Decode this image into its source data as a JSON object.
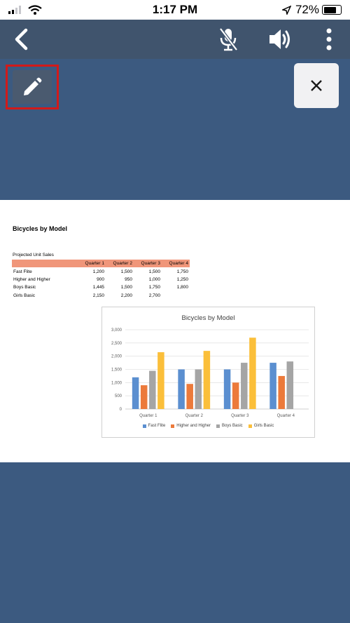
{
  "status_bar": {
    "time": "1:17 PM",
    "battery": "72%"
  },
  "toolbar": {
    "back_icon": "chevron-left-icon",
    "mute_icon": "mic-off-icon",
    "speaker_icon": "speaker-icon",
    "more_icon": "more-vertical-icon"
  },
  "edit_icon": "pencil-icon",
  "close_icon": "close-icon",
  "document": {
    "title": "Bicycles by Model",
    "subtitle": "Projected Unit Sales",
    "columns": [
      "Quarter 1",
      "Quarter 2",
      "Quarter 3",
      "Quarter 4"
    ],
    "rows": [
      {
        "name": "Fast Flite",
        "values": [
          "1,200",
          "1,500",
          "1,500",
          "1,750"
        ]
      },
      {
        "name": "Higher and Higher",
        "values": [
          "900",
          "950",
          "1,000",
          "1,250"
        ]
      },
      {
        "name": "Boys Basic",
        "values": [
          "1,445",
          "1,500",
          "1,750",
          "1,800"
        ]
      },
      {
        "name": "Girls Basic",
        "values": [
          "2,150",
          "2,200",
          "2,700",
          ""
        ]
      }
    ]
  },
  "chart_data": {
    "type": "bar",
    "title": "Bicycles by Model",
    "categories": [
      "Quarter 1",
      "Quarter 2",
      "Quarter 3",
      "Quarter 4"
    ],
    "series": [
      {
        "name": "Fast Flite",
        "values": [
          1200,
          1500,
          1500,
          1750
        ],
        "color": "#5b8fd0"
      },
      {
        "name": "Higher and Higher",
        "values": [
          900,
          950,
          1000,
          1250
        ],
        "color": "#ec7a3b"
      },
      {
        "name": "Boys Basic",
        "values": [
          1445,
          1500,
          1750,
          1800
        ],
        "color": "#a5a5a5"
      },
      {
        "name": "Girls Basic",
        "values": [
          2150,
          2200,
          2700,
          null
        ],
        "color": "#fbbf3a"
      }
    ],
    "ylim": [
      0,
      3000
    ],
    "yticks": [
      "0",
      "500",
      "1,000",
      "1,500",
      "2,000",
      "2,500",
      "3,000"
    ],
    "grid": true,
    "legend": "bottom"
  },
  "colors": {
    "toolbar": "#40546d",
    "background": "#3c5a80",
    "highlight_border": "#d21a1a",
    "header_row": "#f0967a"
  }
}
